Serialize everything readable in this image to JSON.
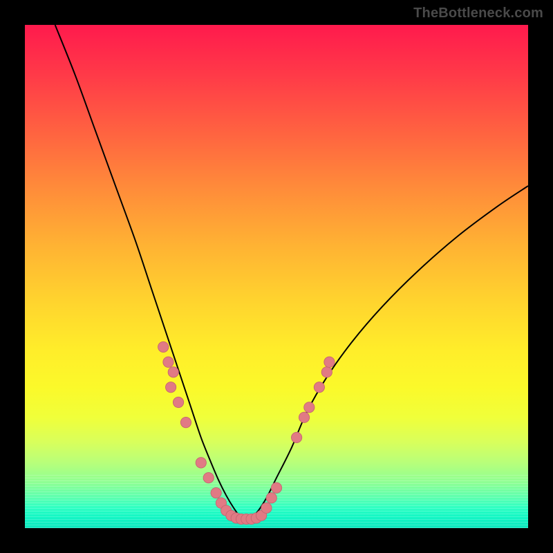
{
  "watermark": "TheBottleneck.com",
  "colors": {
    "curve_stroke": "#000000",
    "marker_fill": "#e17a84",
    "marker_stroke": "#c46470"
  },
  "chart_data": {
    "type": "line",
    "title": "",
    "xlabel": "",
    "ylabel": "",
    "xlim": [
      0,
      100
    ],
    "ylim": [
      0,
      100
    ],
    "series": [
      {
        "name": "left-curve",
        "x": [
          6,
          10,
          14,
          18,
          22,
          25,
          27,
          29,
          31,
          33,
          35,
          37,
          38.5,
          40,
          41.5,
          43,
          44
        ],
        "y": [
          100,
          90,
          79,
          68,
          57,
          48,
          42,
          36,
          30,
          24,
          18,
          13,
          9.5,
          6.5,
          4,
          2,
          1.5
        ]
      },
      {
        "name": "right-curve",
        "x": [
          44,
          46,
          48,
          50,
          53,
          56,
          60,
          65,
          71,
          78,
          86,
          94,
          100
        ],
        "y": [
          1.5,
          3,
          6,
          10,
          16,
          23,
          30,
          37,
          44,
          51,
          58,
          64,
          68
        ]
      }
    ],
    "markers": {
      "name": "sample-points",
      "points": [
        {
          "x": 27.5,
          "y": 36
        },
        {
          "x": 28.5,
          "y": 33
        },
        {
          "x": 29.5,
          "y": 31
        },
        {
          "x": 29.0,
          "y": 28
        },
        {
          "x": 30.5,
          "y": 25
        },
        {
          "x": 32.0,
          "y": 21
        },
        {
          "x": 35.0,
          "y": 13
        },
        {
          "x": 36.5,
          "y": 10
        },
        {
          "x": 38.0,
          "y": 7
        },
        {
          "x": 39.0,
          "y": 5
        },
        {
          "x": 40.0,
          "y": 3.5
        },
        {
          "x": 41.0,
          "y": 2.5
        },
        {
          "x": 42.0,
          "y": 2
        },
        {
          "x": 43.0,
          "y": 1.8
        },
        {
          "x": 44.0,
          "y": 1.8
        },
        {
          "x": 45.0,
          "y": 1.8
        },
        {
          "x": 46.0,
          "y": 2
        },
        {
          "x": 47.0,
          "y": 2.5
        },
        {
          "x": 48.0,
          "y": 4
        },
        {
          "x": 49.0,
          "y": 6
        },
        {
          "x": 50.0,
          "y": 8
        },
        {
          "x": 54.0,
          "y": 18
        },
        {
          "x": 55.5,
          "y": 22
        },
        {
          "x": 56.5,
          "y": 24
        },
        {
          "x": 58.5,
          "y": 28
        },
        {
          "x": 60.0,
          "y": 31
        },
        {
          "x": 60.5,
          "y": 33
        }
      ]
    }
  }
}
